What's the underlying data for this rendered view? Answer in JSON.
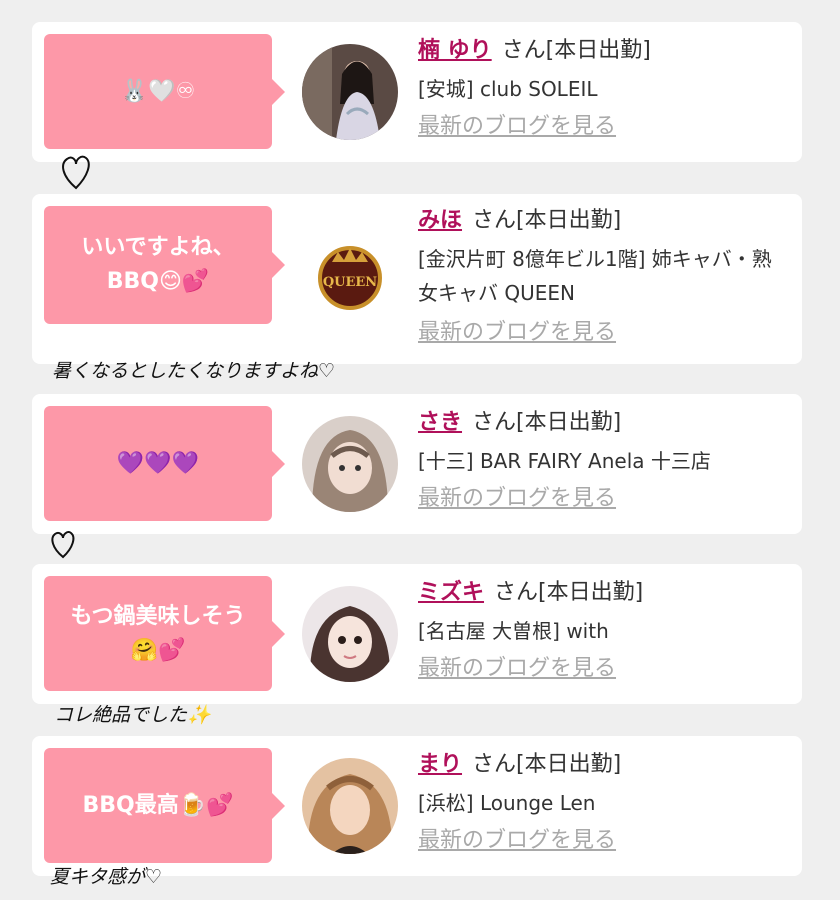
{
  "entries": [
    {
      "comment": "🐰🤍♾",
      "name": "楠 ゆり",
      "suffix": "さん[本日出勤]",
      "shop": "[安城] club SOLEIL",
      "blog": "最新のブログを見る"
    },
    {
      "comment": "いいですよね、\nBBQ😊💕",
      "name": "みほ",
      "suffix": "さん[本日出勤]",
      "shop": "[金沢片町 8億年ビル1階] 姉キャバ・熟女キャバ QUEEN",
      "blog": "最新のブログを見る",
      "logo_text": "QUEEN"
    },
    {
      "comment": "💜💜💜",
      "name": "さき",
      "suffix": "さん[本日出勤]",
      "shop": "[十三] BAR FAIRY Anela 十三店",
      "blog": "最新のブログを見る"
    },
    {
      "comment": "もつ鍋美味しそう\n🤗💕",
      "name": "ミズキ",
      "suffix": "さん[本日出勤]",
      "shop": "[名古屋 大曽根] with",
      "blog": "最新のブログを見る"
    },
    {
      "comment": "BBQ最高🍺💕",
      "name": "まり",
      "suffix": "さん[本日出勤]",
      "shop": "[浜松] Lounge Len",
      "blog": "最新のブログを見る"
    }
  ],
  "handwritten_notes": [
    "暑くなるとしたくなりますよね♡",
    "コレ絶品でした✨",
    "夏キタ感が♡"
  ],
  "colors": {
    "bubble": "#fd98a8",
    "name": "#b0105a",
    "link": "#a9a9a9",
    "card": "#ffffff",
    "background": "#efefef"
  },
  "icons": [
    "heart-doodle-icon"
  ]
}
